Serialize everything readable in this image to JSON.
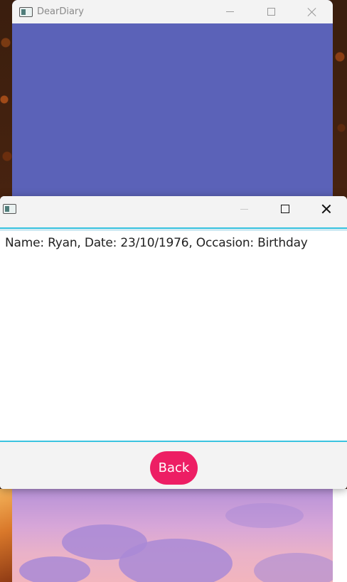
{
  "main_window": {
    "title": "DearDiary",
    "icon": "app-window-icon",
    "background_color": "#5b62b8"
  },
  "dialog": {
    "title": "",
    "icon": "app-window-icon",
    "entry_text": "Name: Ryan, Date: 23/10/1976, Occasion: Birthday",
    "back_label": "Back",
    "accent_color": "#3ac3e0",
    "button_color": "#ed1e64"
  }
}
